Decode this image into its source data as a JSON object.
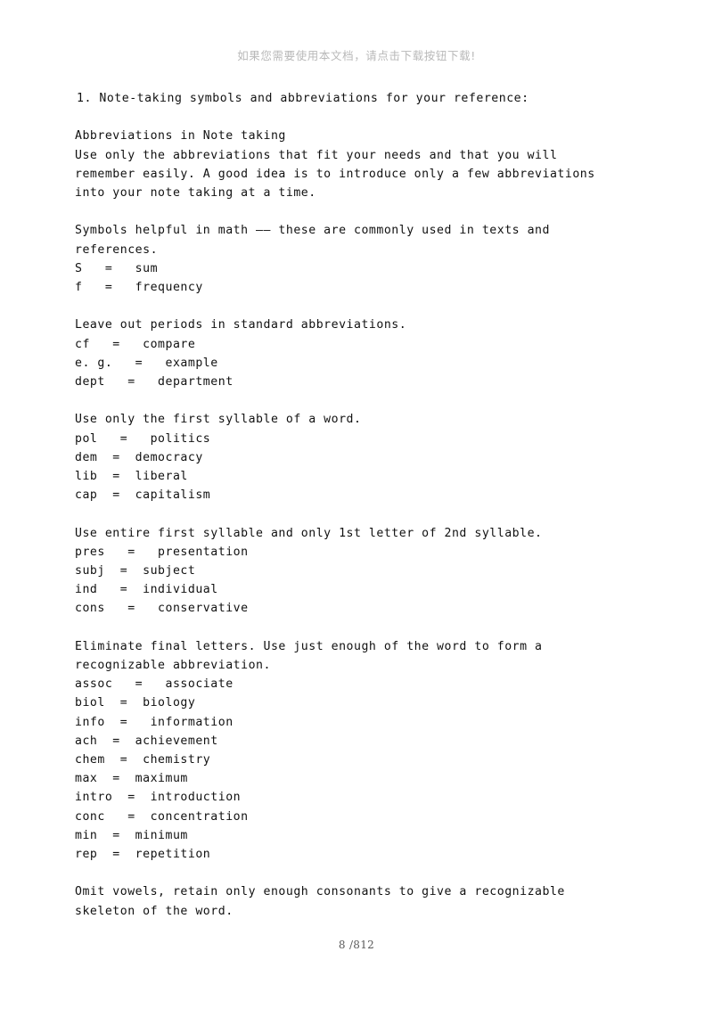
{
  "header": {
    "download_notice": "如果您需要使用本文档，请点击下载按钮下载!"
  },
  "document": {
    "heading": "1. Note-taking symbols and abbreviations for your reference:",
    "lines": [
      "1. Note-taking symbols and abbreviations for your reference:",
      "",
      "Abbreviations in Note taking",
      "Use only the abbreviations that fit your needs and that you will",
      "remember easily. A good idea is to introduce only a few abbreviations",
      "into your note taking at a time.",
      "",
      "Symbols helpful in math —— these are commonly used in texts and",
      "references.",
      "S   =   sum",
      "f   =   frequency",
      "",
      "Leave out periods in standard abbreviations.",
      "cf   =   compare",
      "e. g.   =   example",
      "dept   =   department",
      "",
      "Use only the first syllable of a word.",
      "pol   =   politics",
      "dem  =  democracy",
      "lib  =  liberal",
      "cap  =  capitalism",
      "",
      "Use entire first syllable and only 1st letter of 2nd syllable.",
      "pres   =   presentation",
      "subj  =  subject",
      "ind   =  individual",
      "cons   =   conservative",
      "",
      "Eliminate final letters. Use just enough of the word to form a",
      "recognizable abbreviation.",
      "assoc   =   associate",
      "biol  =  biology",
      "info  =   information",
      "ach  =  achievement",
      "chem  =  chemistry",
      "max  =  maximum",
      "intro  =  introduction",
      "conc   =  concentration",
      "min  =  minimum",
      "rep  =  repetition",
      "",
      "Omit vowels, retain only enough consonants to give a recognizable",
      "skeleton of the word."
    ],
    "sections": [
      {
        "title": "Abbreviations in Note taking",
        "body": "Use only the abbreviations that fit your needs and that you will remember easily. A good idea is to introduce only a few abbreviations into your note taking at a time."
      },
      {
        "title": "Symbols helpful in math —— these are commonly used in texts and references.",
        "entries": [
          {
            "abbr": "S",
            "equals": "=",
            "expansion": "sum"
          },
          {
            "abbr": "f",
            "equals": "=",
            "expansion": "frequency"
          }
        ]
      },
      {
        "title": "Leave out periods in standard abbreviations.",
        "entries": [
          {
            "abbr": "cf",
            "equals": "=",
            "expansion": "compare"
          },
          {
            "abbr": "e. g.",
            "equals": "=",
            "expansion": "example"
          },
          {
            "abbr": "dept",
            "equals": "=",
            "expansion": "department"
          }
        ]
      },
      {
        "title": "Use only the first syllable of a word.",
        "entries": [
          {
            "abbr": "pol",
            "equals": "=",
            "expansion": "politics"
          },
          {
            "abbr": "dem",
            "equals": "=",
            "expansion": "democracy"
          },
          {
            "abbr": "lib",
            "equals": "=",
            "expansion": "liberal"
          },
          {
            "abbr": "cap",
            "equals": "=",
            "expansion": "capitalism"
          }
        ]
      },
      {
        "title": "Use entire first syllable and only 1st letter of 2nd syllable.",
        "entries": [
          {
            "abbr": "pres",
            "equals": "=",
            "expansion": "presentation"
          },
          {
            "abbr": "subj",
            "equals": "=",
            "expansion": "subject"
          },
          {
            "abbr": "ind",
            "equals": "=",
            "expansion": "individual"
          },
          {
            "abbr": "cons",
            "equals": "=",
            "expansion": "conservative"
          }
        ]
      },
      {
        "title": "Eliminate final letters. Use just enough of the word to form a recognizable abbreviation.",
        "entries": [
          {
            "abbr": "assoc",
            "equals": "=",
            "expansion": "associate"
          },
          {
            "abbr": "biol",
            "equals": "=",
            "expansion": "biology"
          },
          {
            "abbr": "info",
            "equals": "=",
            "expansion": "information"
          },
          {
            "abbr": "ach",
            "equals": "=",
            "expansion": "achievement"
          },
          {
            "abbr": "chem",
            "equals": "=",
            "expansion": "chemistry"
          },
          {
            "abbr": "max",
            "equals": "=",
            "expansion": "maximum"
          },
          {
            "abbr": "intro",
            "equals": "=",
            "expansion": "introduction"
          },
          {
            "abbr": "conc",
            "equals": "=",
            "expansion": "concentration"
          },
          {
            "abbr": "min",
            "equals": "=",
            "expansion": "minimum"
          },
          {
            "abbr": "rep",
            "equals": "=",
            "expansion": "repetition"
          }
        ]
      },
      {
        "title": "Omit vowels, retain only enough consonants to give a recognizable skeleton of the word.",
        "entries": []
      }
    ]
  },
  "footer": {
    "page_number": "8 /812"
  },
  "colors": {
    "page_background": "#ffffff",
    "body_text": "#111111",
    "notice_text": "#b9b9b9",
    "footer_text": "#5a5a5a"
  }
}
